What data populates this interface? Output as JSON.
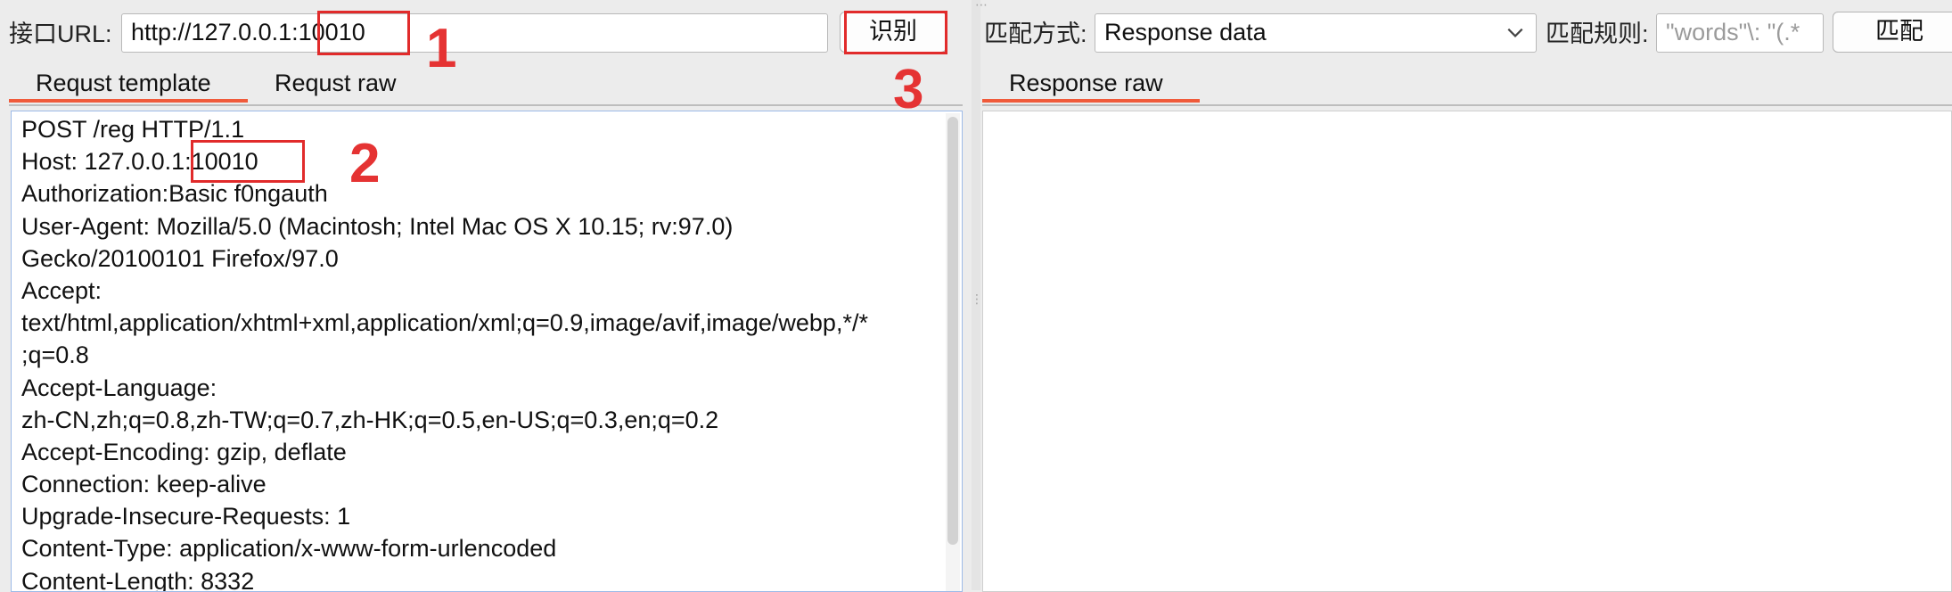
{
  "left": {
    "url_label": "接口URL:",
    "url_value": "http://127.0.0.1:10010",
    "identify_button": "识别",
    "tabs": [
      {
        "label": "Requst template",
        "active": true
      },
      {
        "label": "Requst raw",
        "active": false
      }
    ],
    "request_lines": [
      "POST /reg HTTP/1.1",
      "Host: 127.0.0.1:10010",
      "Authorization:Basic f0ngauth",
      "User-Agent: Mozilla/5.0 (Macintosh; Intel Mac OS X 10.15; rv:97.0)",
      "Gecko/20100101 Firefox/97.0",
      "Accept:",
      "text/html,application/xhtml+xml,application/xml;q=0.9,image/avif,image/webp,*/*",
      ";q=0.8",
      "Accept-Language:",
      "zh-CN,zh;q=0.8,zh-TW;q=0.7,zh-HK;q=0.5,en-US;q=0.3,en;q=0.2",
      "Accept-Encoding: gzip, deflate",
      "Connection: keep-alive",
      "Upgrade-Insecure-Requests: 1",
      "Content-Type: application/x-www-form-urlencoded",
      "Content-Length: 8332"
    ]
  },
  "right": {
    "match_mode_label": "匹配方式:",
    "match_mode_value": "Response data",
    "match_rule_label": "匹配规则:",
    "match_rule_placeholder": "\"words\"\\: \"(.*",
    "match_button": "匹配",
    "tabs": [
      {
        "label": "Response raw",
        "active": true
      }
    ]
  },
  "annotations": {
    "one": "1",
    "two": "2",
    "three": "3"
  },
  "colors": {
    "accent_tab": "#f05a3a",
    "annotation_red": "#e12b2b",
    "editor_border": "#9dbbe8"
  }
}
